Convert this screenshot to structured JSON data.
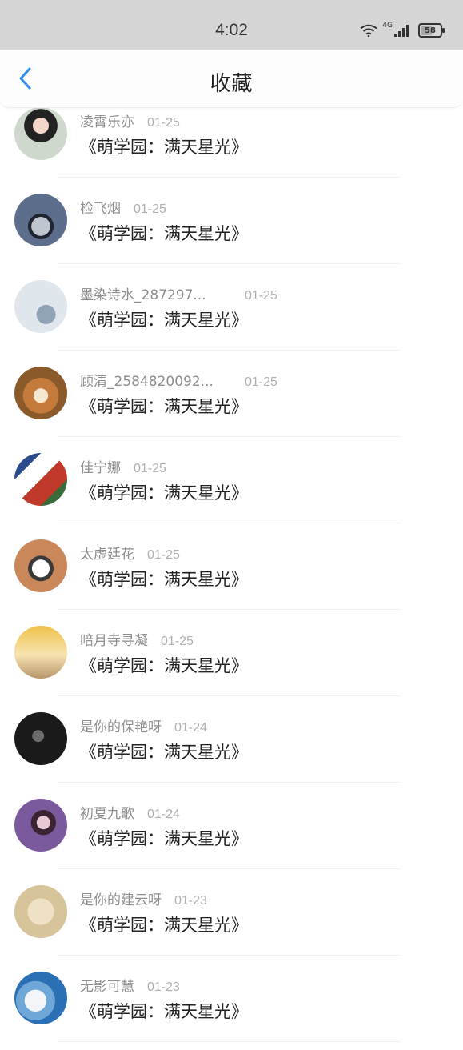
{
  "status_bar": {
    "time": "4:02",
    "network_label": "4G",
    "battery": "58",
    "battery_level": 0.58
  },
  "header": {
    "title": "收藏",
    "back_icon": "chevron-left-icon",
    "accent_color": "#2f8ef4"
  },
  "items": [
    {
      "user": "凌霄乐亦",
      "date": "01-25",
      "title": "《萌学园：满天星光》"
    },
    {
      "user": "检飞烟",
      "date": "01-25",
      "title": "《萌学园：满天星光》"
    },
    {
      "user": "墨染诗水_287297...",
      "date": "01-25",
      "title": "《萌学园：满天星光》"
    },
    {
      "user": "顾清_2584820092...",
      "date": "01-25",
      "title": "《萌学园：满天星光》"
    },
    {
      "user": "佳宁娜",
      "date": "01-25",
      "title": "《萌学园：满天星光》"
    },
    {
      "user": "太虚廷花",
      "date": "01-25",
      "title": "《萌学园：满天星光》"
    },
    {
      "user": "暗月寺寻凝",
      "date": "01-25",
      "title": "《萌学园：满天星光》"
    },
    {
      "user": "是你的保艳呀",
      "date": "01-24",
      "title": "《萌学园：满天星光》"
    },
    {
      "user": "初夏九歌",
      "date": "01-24",
      "title": "《萌学园：满天星光》"
    },
    {
      "user": "是你的建云呀",
      "date": "01-23",
      "title": "《萌学园：满天星光》"
    },
    {
      "user": "无影可慧",
      "date": "01-23",
      "title": "《萌学园：满天星光》"
    }
  ]
}
